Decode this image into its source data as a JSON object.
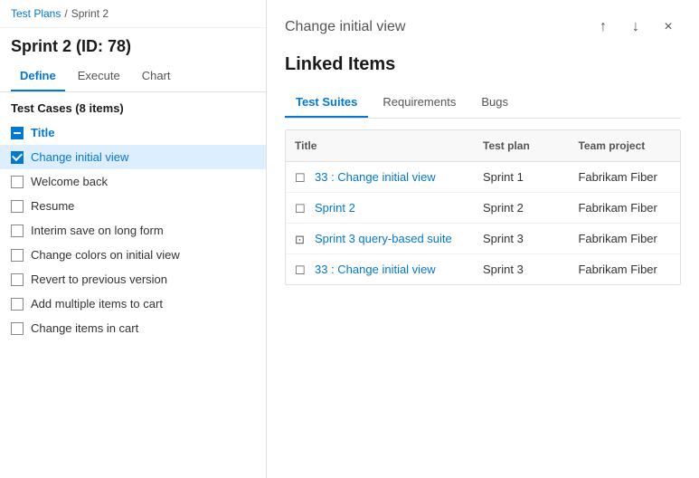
{
  "breadcrumb": {
    "part1": "Test Plans",
    "sep": "/",
    "part2": "Sprint 2"
  },
  "sprint": {
    "title": "Sprint 2 (ID: 78)"
  },
  "left_tabs": [
    {
      "label": "Define",
      "active": true
    },
    {
      "label": "Execute",
      "active": false
    },
    {
      "label": "Chart",
      "active": false
    }
  ],
  "test_cases_header": "Test Cases (8 items)",
  "test_cases": [
    {
      "id": 0,
      "text": "Title",
      "type": "header",
      "selected": false
    },
    {
      "id": 1,
      "text": "Change initial view",
      "type": "checked",
      "selected": true
    },
    {
      "id": 2,
      "text": "Welcome back",
      "type": "unchecked",
      "selected": false
    },
    {
      "id": 3,
      "text": "Resume",
      "type": "unchecked",
      "selected": false
    },
    {
      "id": 4,
      "text": "Interim save on long form",
      "type": "unchecked",
      "selected": false
    },
    {
      "id": 5,
      "text": "Change colors on initial view",
      "type": "unchecked",
      "selected": false
    },
    {
      "id": 6,
      "text": "Revert to previous version",
      "type": "unchecked",
      "selected": false
    },
    {
      "id": 7,
      "text": "Add multiple items to cart",
      "type": "unchecked",
      "selected": false
    },
    {
      "id": 8,
      "text": "Change items in cart",
      "type": "unchecked",
      "selected": false
    }
  ],
  "right_panel": {
    "title": "Change initial view",
    "linked_items_heading": "Linked Items",
    "up_icon": "↑",
    "down_icon": "↓",
    "close_icon": "×",
    "tabs": [
      {
        "label": "Test Suites",
        "active": true,
        "color": "blue"
      },
      {
        "label": "Requirements",
        "active": false,
        "color": "blue"
      },
      {
        "label": "Bugs",
        "active": false,
        "color": "orange"
      }
    ],
    "table_headers": {
      "title": "Title",
      "test_plan": "Test plan",
      "team_project": "Team project"
    },
    "rows": [
      {
        "icon": "static",
        "title": "33 : Change initial view",
        "test_plan": "Sprint 1",
        "team_project": "Fabrikam Fiber"
      },
      {
        "icon": "static",
        "title": "Sprint 2",
        "test_plan": "Sprint 2",
        "team_project": "Fabrikam Fiber"
      },
      {
        "icon": "query",
        "title": "Sprint 3 query-based suite",
        "test_plan": "Sprint 3",
        "team_project": "Fabrikam Fiber"
      },
      {
        "icon": "static",
        "title": "33 : Change initial view",
        "test_plan": "Sprint 3",
        "team_project": "Fabrikam Fiber"
      }
    ]
  }
}
